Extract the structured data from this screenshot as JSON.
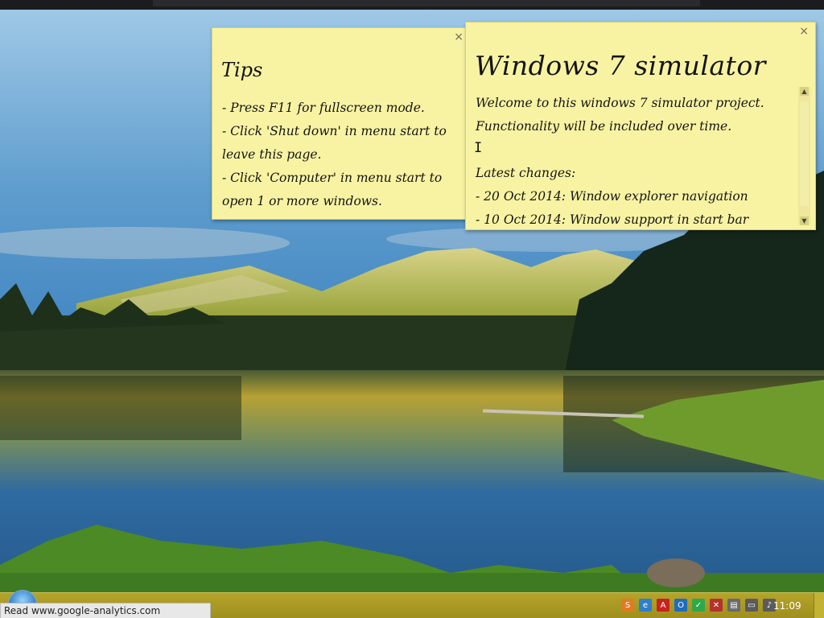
{
  "notes": {
    "tips": {
      "title": "Tips",
      "close": "×",
      "items": [
        "- Press F11 for fullscreen mode.",
        "- Click 'Shut down' in menu start to leave this page.",
        "- Click 'Computer' in menu start to open 1 or more windows."
      ]
    },
    "main": {
      "title": "Windows 7 simulator",
      "close": "×",
      "lines": [
        "Welcome to this windows 7 simulator project.",
        "Functionality will be included over time.",
        "",
        "Latest changes:",
        "- 20 Oct 2014: Window explorer navigation",
        "- 10 Oct 2014: Window support in start bar"
      ],
      "scroll_up": "▲",
      "scroll_down": "▼"
    }
  },
  "cursor": "I",
  "status_bar": {
    "text": "Read www.google-analytics.com"
  },
  "taskbar": {
    "clock": "11:09",
    "tray_icons": [
      {
        "name": "app-orange-icon",
        "glyph": "S",
        "color": "#e07b22"
      },
      {
        "name": "network-globe-icon",
        "glyph": "e",
        "color": "#2f7fc9"
      },
      {
        "name": "pdf-icon",
        "glyph": "A",
        "color": "#c8231f"
      },
      {
        "name": "outlook-icon",
        "glyph": "O",
        "color": "#1f6cbf"
      },
      {
        "name": "shield-check-icon",
        "glyph": "✓",
        "color": "#2fa84a"
      },
      {
        "name": "flag-error-icon",
        "glyph": "✕",
        "color": "#b5322c"
      },
      {
        "name": "clipboard-icon",
        "glyph": "▤",
        "color": "#6a6a6a"
      },
      {
        "name": "monitor-icon",
        "glyph": "▭",
        "color": "#5b5b5b"
      },
      {
        "name": "volume-icon",
        "glyph": "♪",
        "color": "#5b5b5b"
      }
    ]
  }
}
